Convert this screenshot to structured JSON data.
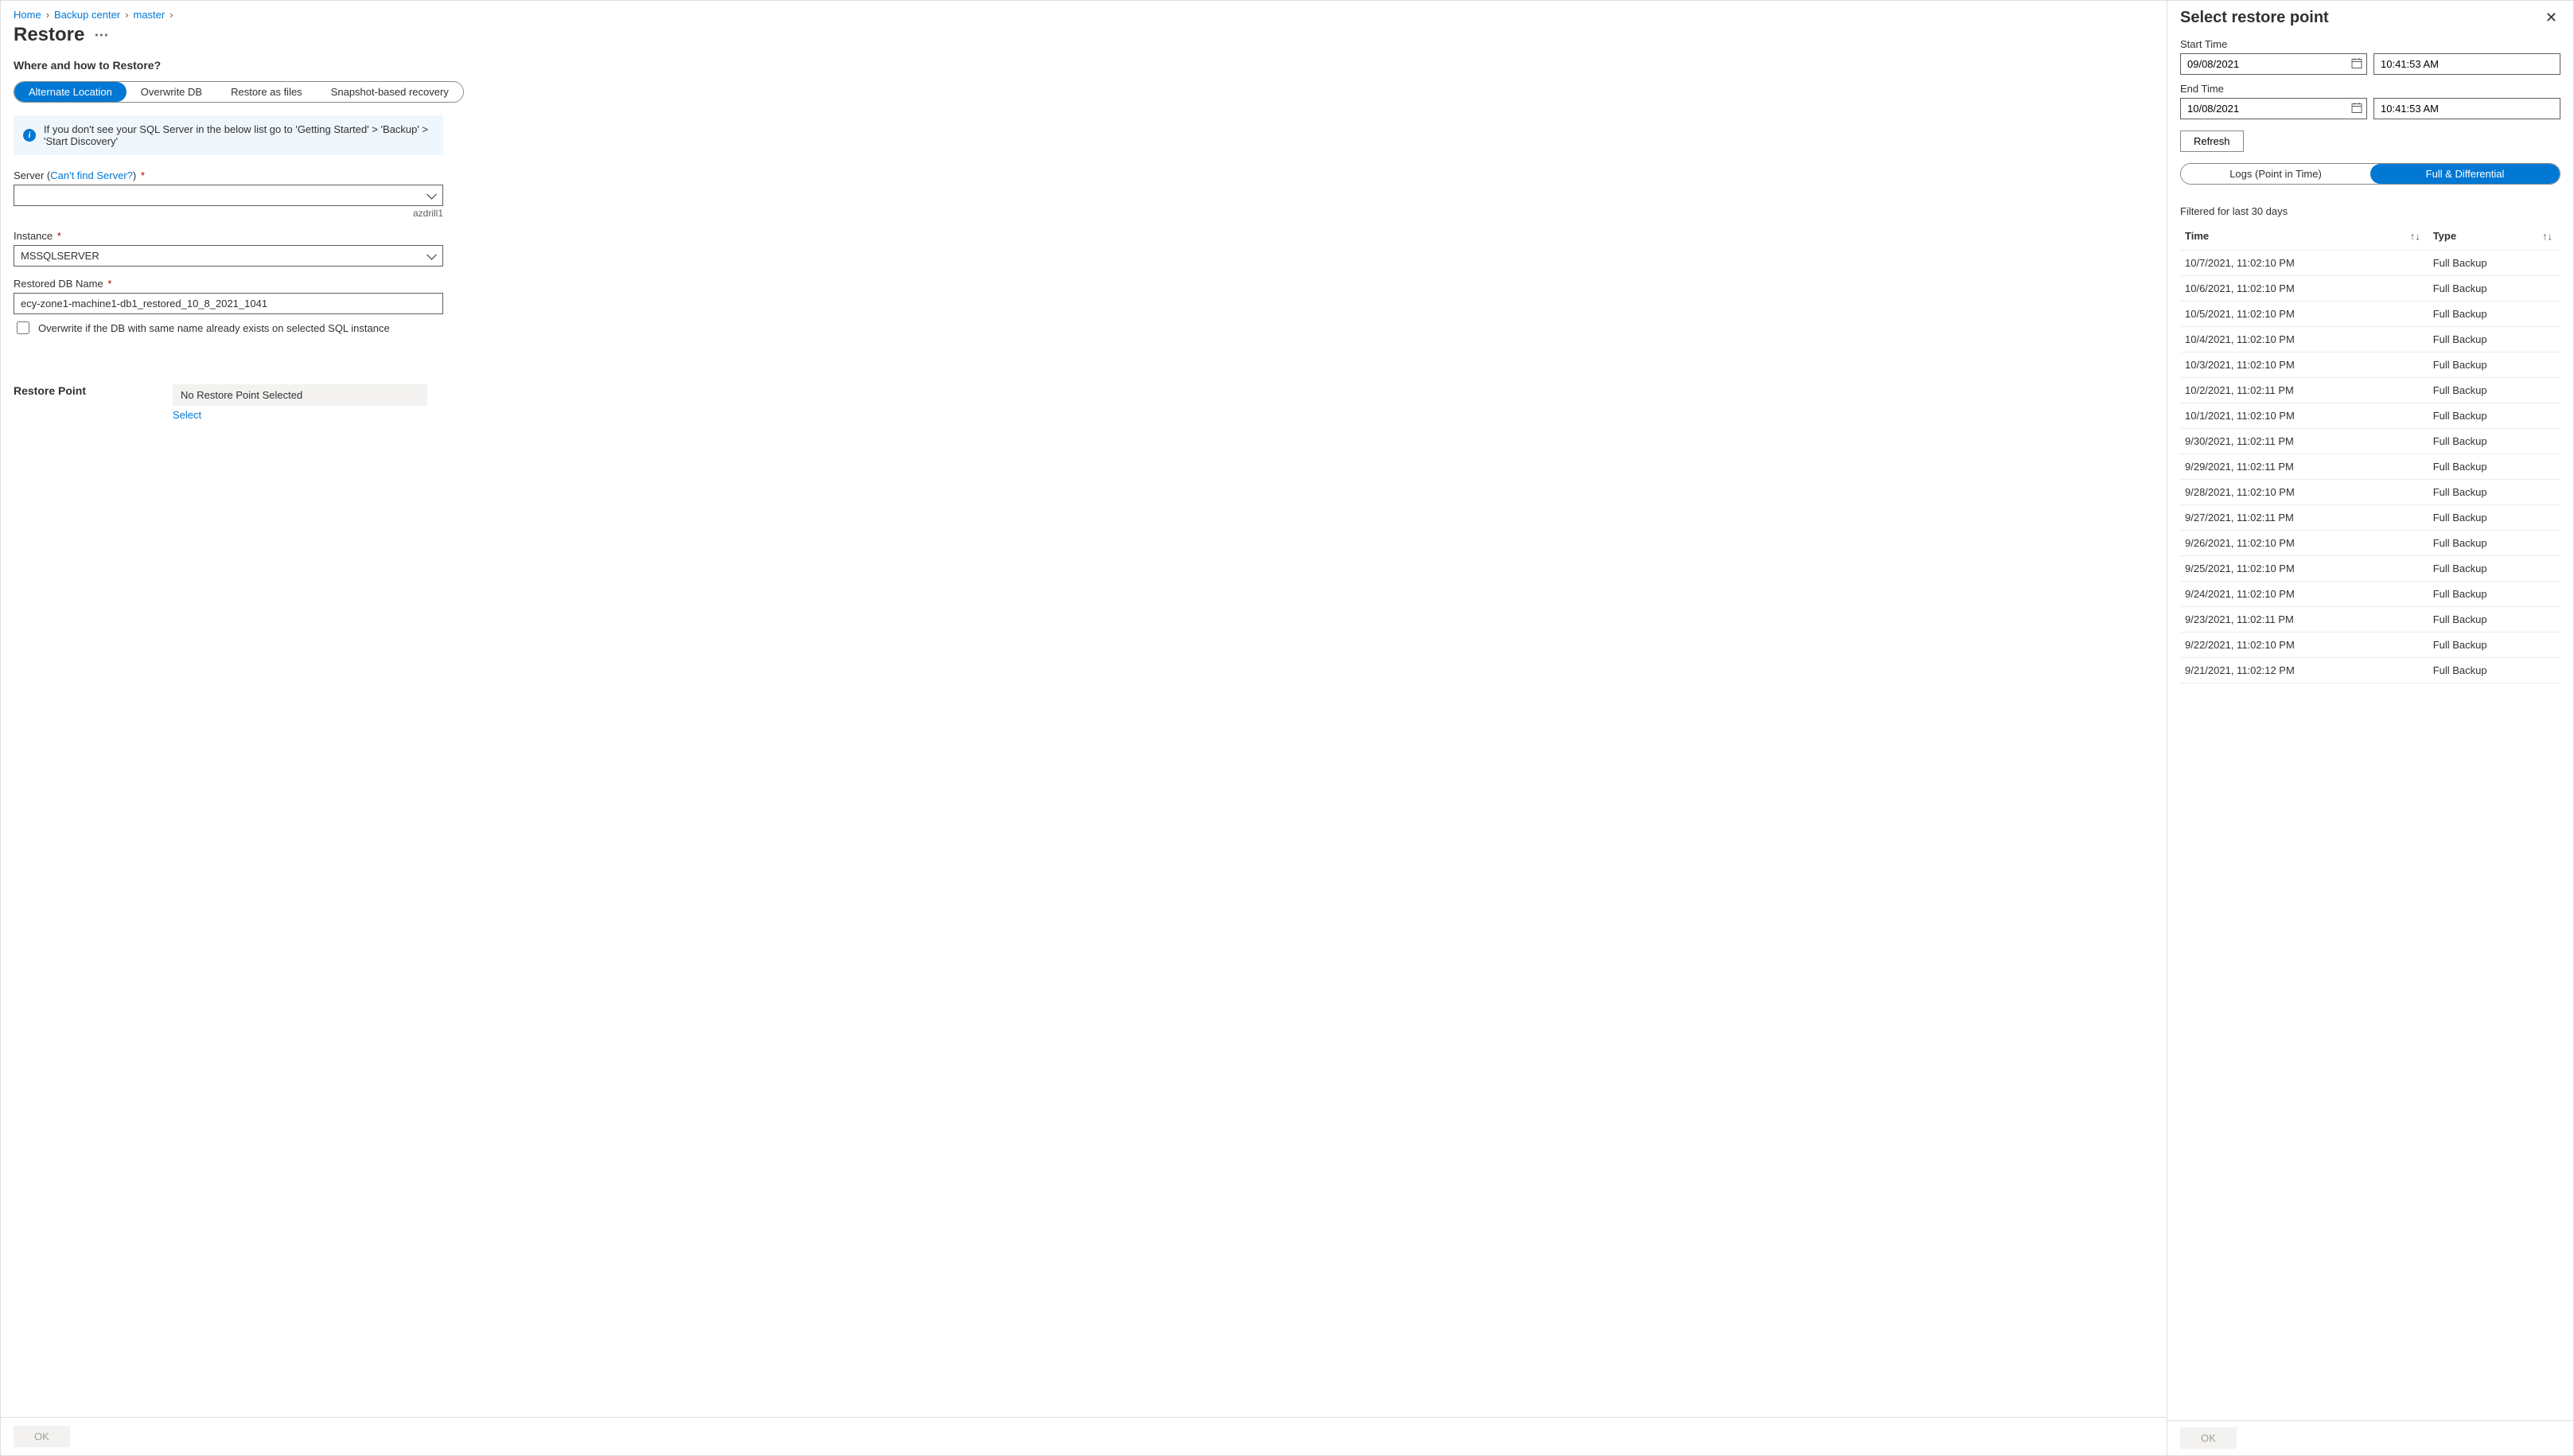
{
  "breadcrumb": {
    "items": [
      "Home",
      "Backup center",
      "master"
    ]
  },
  "page": {
    "title": "Restore"
  },
  "section1": {
    "heading": "Where and how to Restore?",
    "options": [
      "Alternate Location",
      "Overwrite DB",
      "Restore as files",
      "Snapshot-based recovery"
    ],
    "info": "If you don't see your SQL Server in the below list go to 'Getting Started' > 'Backup' > 'Start Discovery'"
  },
  "form": {
    "server_label": "Server (",
    "server_link": "Can't find Server?",
    "server_label_close": ")",
    "server_value": "",
    "server_helper": "azdrill1",
    "instance_label": "Instance",
    "instance_value": "MSSQLSERVER",
    "restored_label": "Restored DB Name",
    "restored_value": "ecy-zone1-machine1-db1_restored_10_8_2021_1041",
    "overwrite_label": "Overwrite if the DB with same name already exists on selected SQL instance"
  },
  "restore_point": {
    "label": "Restore Point",
    "value": "No Restore Point Selected",
    "select_link": "Select"
  },
  "footer": {
    "ok": "OK"
  },
  "panel": {
    "title": "Select restore point",
    "start_label": "Start Time",
    "start_date": "09/08/2021",
    "start_time": "10:41:53 AM",
    "end_label": "End Time",
    "end_date": "10/08/2021",
    "end_time": "10:41:53 AM",
    "refresh": "Refresh",
    "tabs": [
      "Logs (Point in Time)",
      "Full & Differential"
    ],
    "filter_note": "Filtered for last 30 days",
    "col_time": "Time",
    "col_type": "Type",
    "rows": [
      {
        "time": "10/7/2021, 11:02:10 PM",
        "type": "Full Backup"
      },
      {
        "time": "10/6/2021, 11:02:10 PM",
        "type": "Full Backup"
      },
      {
        "time": "10/5/2021, 11:02:10 PM",
        "type": "Full Backup"
      },
      {
        "time": "10/4/2021, 11:02:10 PM",
        "type": "Full Backup"
      },
      {
        "time": "10/3/2021, 11:02:10 PM",
        "type": "Full Backup"
      },
      {
        "time": "10/2/2021, 11:02:11 PM",
        "type": "Full Backup"
      },
      {
        "time": "10/1/2021, 11:02:10 PM",
        "type": "Full Backup"
      },
      {
        "time": "9/30/2021, 11:02:11 PM",
        "type": "Full Backup"
      },
      {
        "time": "9/29/2021, 11:02:11 PM",
        "type": "Full Backup"
      },
      {
        "time": "9/28/2021, 11:02:10 PM",
        "type": "Full Backup"
      },
      {
        "time": "9/27/2021, 11:02:11 PM",
        "type": "Full Backup"
      },
      {
        "time": "9/26/2021, 11:02:10 PM",
        "type": "Full Backup"
      },
      {
        "time": "9/25/2021, 11:02:10 PM",
        "type": "Full Backup"
      },
      {
        "time": "9/24/2021, 11:02:10 PM",
        "type": "Full Backup"
      },
      {
        "time": "9/23/2021, 11:02:11 PM",
        "type": "Full Backup"
      },
      {
        "time": "9/22/2021, 11:02:10 PM",
        "type": "Full Backup"
      },
      {
        "time": "9/21/2021, 11:02:12 PM",
        "type": "Full Backup"
      }
    ],
    "ok": "OK"
  }
}
